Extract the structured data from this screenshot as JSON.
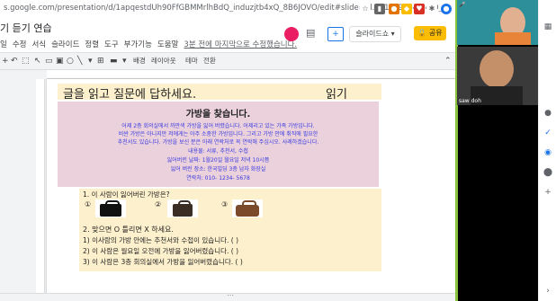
{
  "browser": {
    "url": "s.google.com/presentation/d/1apqestdUh90FfGBMMrlhBdQ_induzjtb4xQ_8B6JOVO/edit#slide=id.g112c9ab4fb4_0_0"
  },
  "doc": {
    "title": "기 듣기 연습",
    "menu": [
      "일",
      "수정",
      "서식",
      "슬라이드",
      "정렬",
      "도구",
      "부가기능",
      "도움말"
    ],
    "last_edit": "3분 전에 마지막으로 수정했습니다.",
    "slideshow_label": "슬라이드쇼",
    "share_label": "공유"
  },
  "toolbar": {
    "background_label": "배경",
    "layout_label": "레이아웃",
    "theme_label": "테마",
    "transition_label": "전환"
  },
  "slide": {
    "heading": "글을 읽고 질문에 답하세요.",
    "heading_right": "읽기",
    "notice": {
      "title": "가방을 찾습니다.",
      "lines": [
        "어제 2층 회의실에서 까만색 가방을 잃어 버렸습니다. 어제리고 있는 가족 가방입니다.",
        "비싼 가방은 아니지만 저에게는 아주 소중한 가방입니다. 그리고 가방 안에 취직에 필요한",
        "추천서도 있습니다. 가방을 보신 분은 아래 연락처로 꼭 연락해 주십시오. 사례하겠습니다.",
        "내용물: 서류, 추천서, 수첩",
        "잃어버린 날짜: 1월20일 월요일 저녁 10시쯤",
        "잃어 버린 장소: 한국빌딩 3층 남자 화장실",
        "연락처: 010- 1234- 5678"
      ]
    },
    "questions": {
      "q1": "1. 이 사람이 잃어버린 가방은?",
      "opt1": "①",
      "opt2": "②",
      "opt3": "③",
      "q2": "2. 맞으면 O  틀리면 X 하세요.",
      "s1": "1) 이사람의 가방 안에는 추천서와 수첩이 있습니다. (     )",
      "s2": "2) 이 사람은 월요일 오전에 가방을 잃어버렸습니다. (     )",
      "s3": "3) 이 사람은 3층 회의실에서 가방을 잃어버렸습니다. (     )"
    }
  },
  "video": {
    "participant2": "saw doh"
  }
}
